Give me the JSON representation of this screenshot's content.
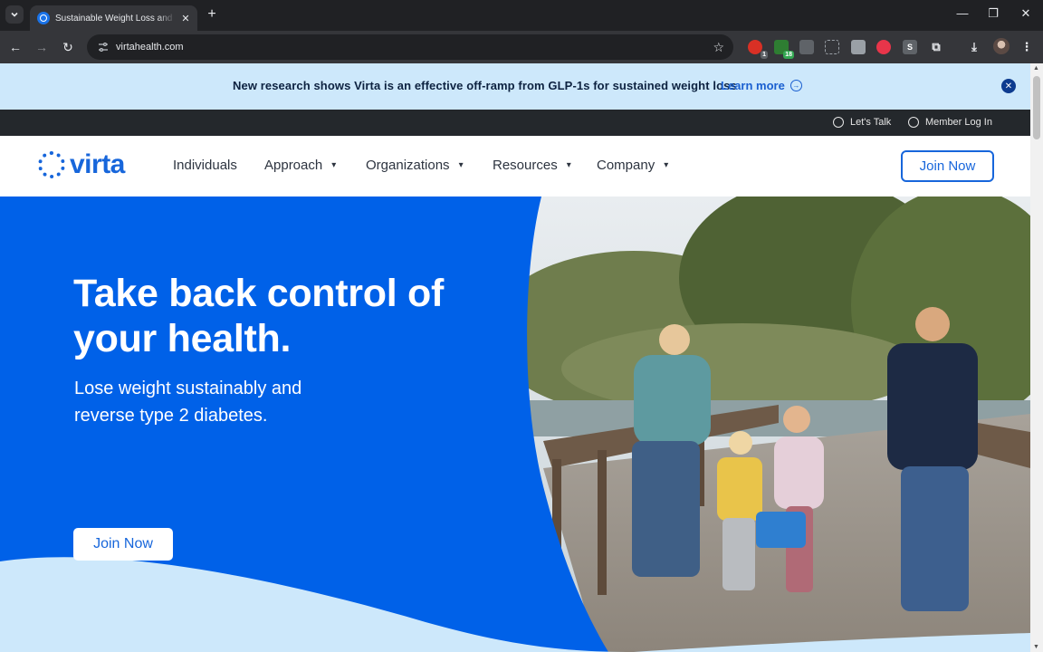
{
  "browser": {
    "tab_title": "Sustainable Weight Loss and Diabetes",
    "url": "virtahealth.com",
    "extensions": [
      {
        "name": "ext-1",
        "badge": "1"
      },
      {
        "name": "ext-2",
        "badge": "18"
      },
      {
        "name": "ext-3",
        "badge": ""
      },
      {
        "name": "ext-4",
        "badge": ""
      },
      {
        "name": "ext-5",
        "badge": ""
      },
      {
        "name": "ext-6",
        "badge": ""
      },
      {
        "name": "ext-7",
        "badge": ""
      }
    ]
  },
  "announcement": {
    "text": "New research shows Virta is an effective off-ramp from GLP-1s for sustained weight loss",
    "link": "Learn more"
  },
  "utility": {
    "lets_talk": "Let's Talk",
    "member_login": "Member Log In"
  },
  "nav": {
    "logo": "virta",
    "items": [
      {
        "label": "Individuals"
      },
      {
        "label": "Approach"
      },
      {
        "label": "Organizations"
      },
      {
        "label": "Resources"
      },
      {
        "label": "Company"
      }
    ],
    "cta": "Join Now"
  },
  "hero": {
    "title": "Take back control of your health.",
    "subtitle": "Lose weight sustainably and reverse type 2 diabetes.",
    "cta": "Join Now"
  },
  "colors": {
    "brand_blue": "#1766db",
    "banner_bg": "#cde8fb",
    "utility_bg": "#24282c",
    "hero_blue": "#0061e8"
  }
}
